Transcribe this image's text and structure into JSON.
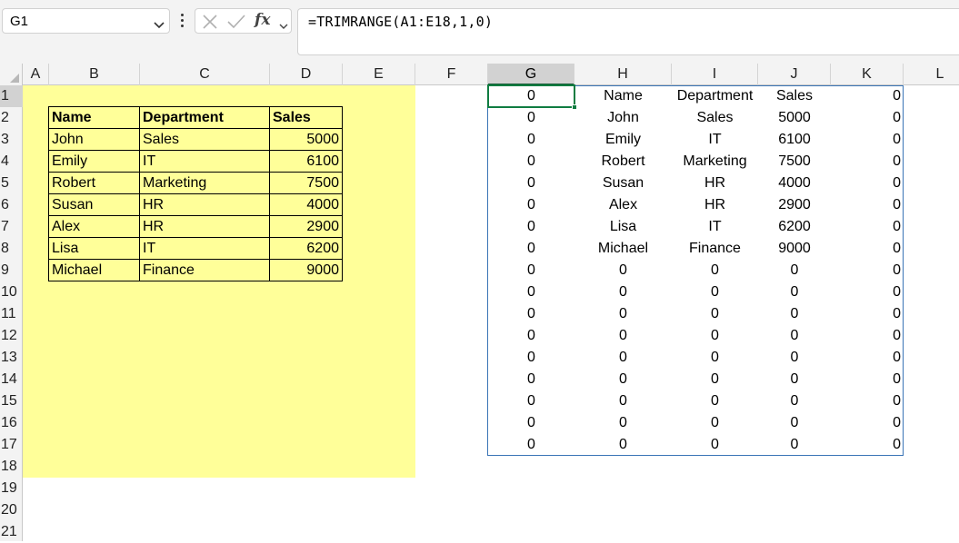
{
  "name_box": {
    "value": "G1"
  },
  "formula_bar": {
    "formula": "=TRIMRANGE(A1:E18,1,0)",
    "fx_label": "fx"
  },
  "icons": {
    "name_box_dropdown": "chevron-down-icon",
    "more_options": "vertical-dots-icon",
    "cancel": "close-icon",
    "enter": "check-icon",
    "function": "fx-icon",
    "function_dropdown": "chevron-down-icon"
  },
  "columns": [
    "A",
    "B",
    "C",
    "D",
    "E",
    "F",
    "G",
    "H",
    "I",
    "J",
    "K",
    "L"
  ],
  "selected_column": "G",
  "rows": [
    "1",
    "2",
    "3",
    "4",
    "5",
    "6",
    "7",
    "8",
    "9",
    "10",
    "11",
    "12",
    "13",
    "14",
    "15",
    "16",
    "17",
    "18",
    "19",
    "20",
    "21"
  ],
  "selected_row": "1",
  "colors": {
    "source_highlight": "#ffff99",
    "active_cell_border": "#107c41",
    "spill_border": "#3a74b6"
  },
  "source_table": {
    "headers": [
      "Name",
      "Department",
      "Sales"
    ],
    "rows": [
      [
        "John",
        "Sales",
        "5000"
      ],
      [
        "Emily",
        "IT",
        "6100"
      ],
      [
        "Robert",
        "Marketing",
        "7500"
      ],
      [
        "Susan",
        "HR",
        "4000"
      ],
      [
        "Alex",
        "HR",
        "2900"
      ],
      [
        "Lisa",
        "IT",
        "6200"
      ],
      [
        "Michael",
        "Finance",
        "9000"
      ]
    ]
  },
  "spill_result": {
    "rows": [
      [
        "0",
        "Name",
        "Department",
        "Sales",
        "0"
      ],
      [
        "0",
        "John",
        "Sales",
        "5000",
        "0"
      ],
      [
        "0",
        "Emily",
        "IT",
        "6100",
        "0"
      ],
      [
        "0",
        "Robert",
        "Marketing",
        "7500",
        "0"
      ],
      [
        "0",
        "Susan",
        "HR",
        "4000",
        "0"
      ],
      [
        "0",
        "Alex",
        "HR",
        "2900",
        "0"
      ],
      [
        "0",
        "Lisa",
        "IT",
        "6200",
        "0"
      ],
      [
        "0",
        "Michael",
        "Finance",
        "9000",
        "0"
      ],
      [
        "0",
        "0",
        "0",
        "0",
        "0"
      ],
      [
        "0",
        "0",
        "0",
        "0",
        "0"
      ],
      [
        "0",
        "0",
        "0",
        "0",
        "0"
      ],
      [
        "0",
        "0",
        "0",
        "0",
        "0"
      ],
      [
        "0",
        "0",
        "0",
        "0",
        "0"
      ],
      [
        "0",
        "0",
        "0",
        "0",
        "0"
      ],
      [
        "0",
        "0",
        "0",
        "0",
        "0"
      ],
      [
        "0",
        "0",
        "0",
        "0",
        "0"
      ],
      [
        "0",
        "0",
        "0",
        "0",
        "0"
      ]
    ]
  }
}
